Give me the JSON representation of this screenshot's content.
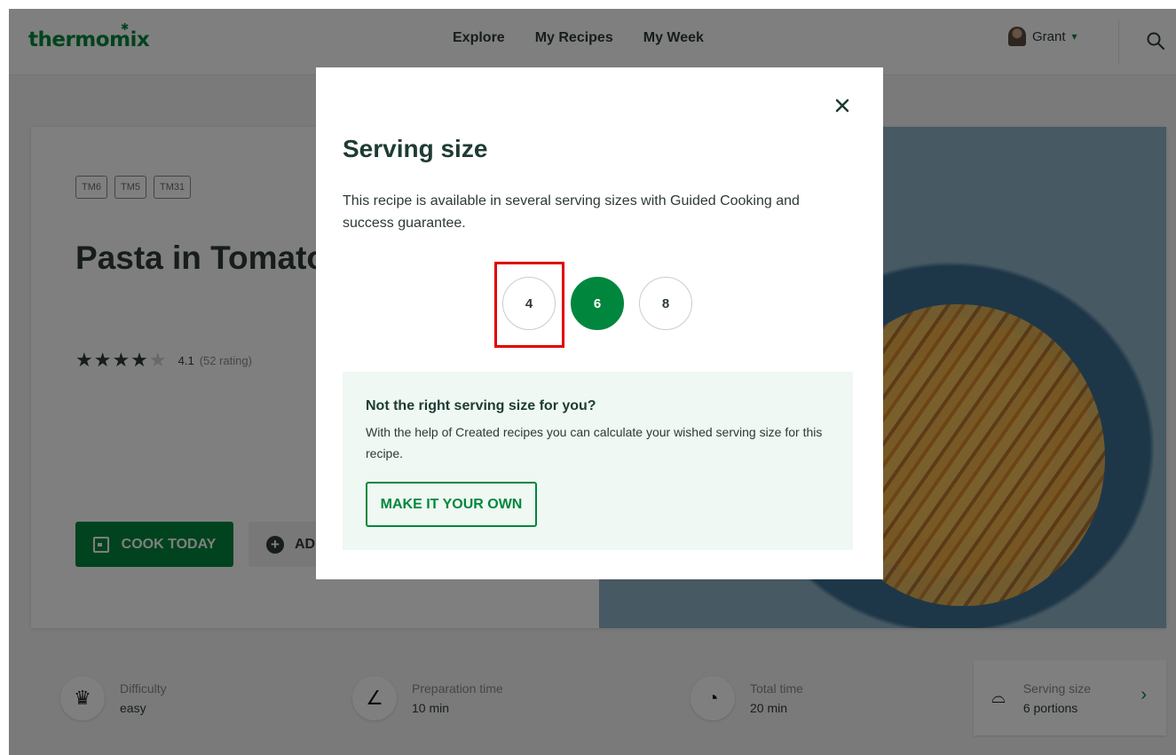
{
  "header": {
    "logo": "thermomix",
    "nav": [
      "Explore",
      "My Recipes",
      "My Week"
    ],
    "user_name": "Grant",
    "search_icon": "search-icon"
  },
  "recipe": {
    "chips": [
      "TM6",
      "TM5",
      "TM31"
    ],
    "title": "Pasta in Tomato Chorizo",
    "rating": {
      "stars": 4,
      "value": "4.1",
      "count": "(52 rating)"
    },
    "cook_button": "COOK TODAY",
    "add_button": "AD"
  },
  "info": {
    "difficulty": {
      "label": "Difficulty",
      "value": "easy"
    },
    "prep": {
      "label": "Preparation time",
      "value": "10 min"
    },
    "total": {
      "label": "Total time",
      "value": "20 min"
    },
    "serving": {
      "label": "Serving size",
      "value": "6 portions"
    }
  },
  "modal": {
    "title": "Serving size",
    "description": "This recipe is available in several serving sizes with Guided Cooking and success guarantee.",
    "options": [
      "4",
      "6",
      "8"
    ],
    "selected": "6",
    "tip": {
      "title": "Not the right serving size for you?",
      "text": "With the help of Created recipes you can calculate your wished serving size for this recipe.",
      "button": "MAKE IT YOUR OWN"
    }
  },
  "colors": {
    "brand_green": "#00873d",
    "highlight_red": "#e10000",
    "tip_bg": "#eff8f2"
  }
}
